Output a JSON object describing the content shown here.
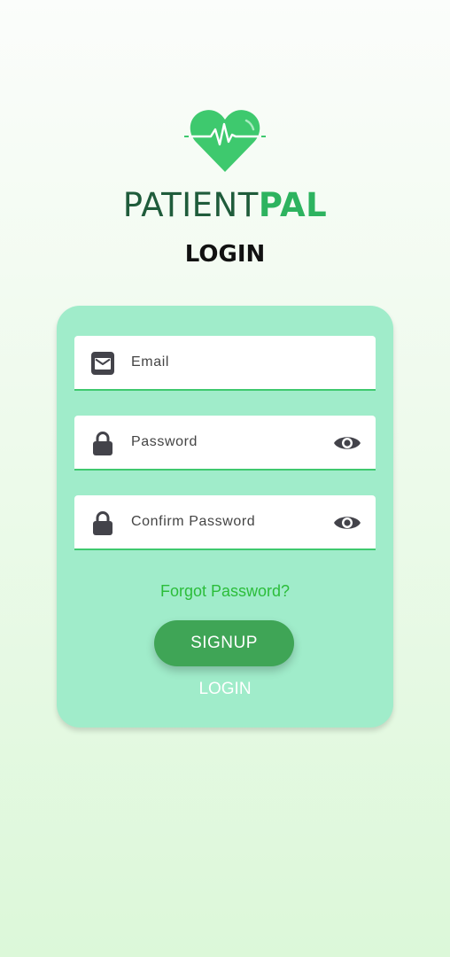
{
  "brand": {
    "name_light": "PATIENT",
    "name_bold": "PAL",
    "logo_icon": "heart-pulse-icon"
  },
  "page_title": "LOGIN",
  "form": {
    "email": {
      "placeholder": "Email",
      "icon": "envelope-icon"
    },
    "password": {
      "placeholder": "Password",
      "icon": "lock-icon",
      "toggle_icon": "eye-icon"
    },
    "confirm_password": {
      "placeholder": "Confirm Password",
      "icon": "lock-icon",
      "toggle_icon": "eye-icon"
    },
    "forgot_password": "Forgot Password?",
    "signup_button": "SIGNUP",
    "login_link": "LOGIN"
  },
  "colors": {
    "card_background": "#a0ecca",
    "brand_dark": "#1f5c3b",
    "brand_green": "#2db35f",
    "button_green": "#3fa556",
    "link_green": "#2bbd3a",
    "field_underline": "#3ec96e"
  }
}
